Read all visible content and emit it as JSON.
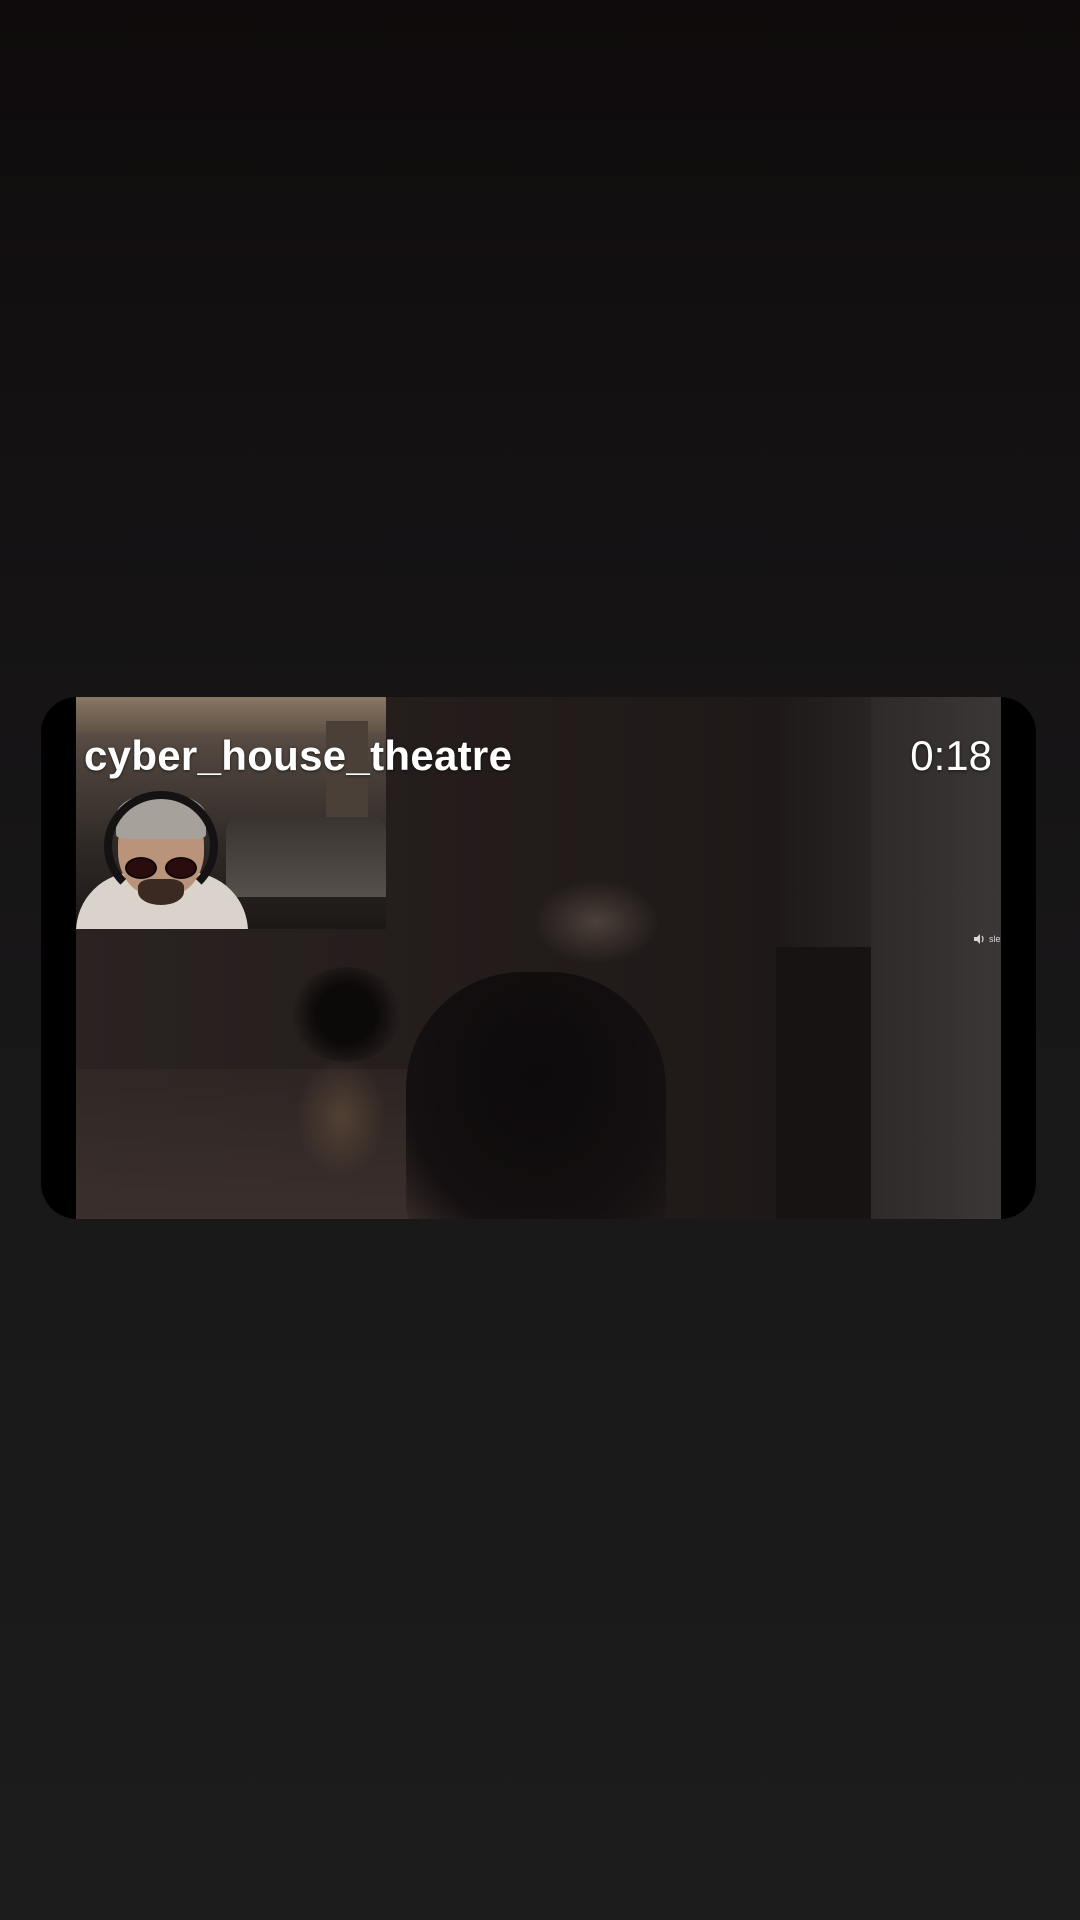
{
  "video": {
    "channel_name": "cyber_house_theatre",
    "elapsed_time": "0:18",
    "volume_hint": "sle"
  },
  "icons": {
    "volume": "speaker-icon"
  }
}
